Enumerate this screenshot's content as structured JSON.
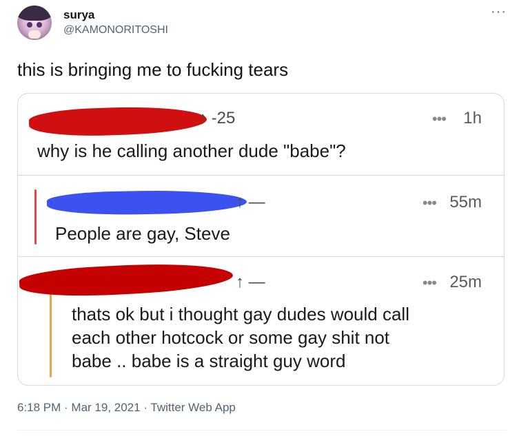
{
  "user": {
    "display_name": "surya",
    "handle": "@KAMONORITOSHI",
    "more_icon": "more-dots-icon"
  },
  "tweet": {
    "text": "this is bringing me to fucking tears"
  },
  "embed": {
    "comments": [
      {
        "score": "↑ -25",
        "dots": "•••",
        "time": "1h",
        "text": "why is he calling another dude \"babe\"?",
        "redaction_color": "#d01010"
      },
      {
        "score": "↑ —",
        "dots": "•••",
        "time": "55m",
        "text": "People are gay, Steve",
        "redaction_color": "#3b52f0",
        "thread_bar_color": "#e24a4a"
      },
      {
        "score": "↑ —",
        "dots": "•••",
        "time": "25m",
        "text_lines": [
          "thats ok but i thought gay dudes would call",
          "each other hotcock or some gay shit not",
          "babe .. babe is a straight guy word"
        ],
        "redaction_color": "#c40000",
        "thread_bar_color": "#f0a04b"
      }
    ]
  },
  "meta": {
    "timestamp": "6:18 PM · Mar 19, 2021 · Twitter Web App"
  }
}
